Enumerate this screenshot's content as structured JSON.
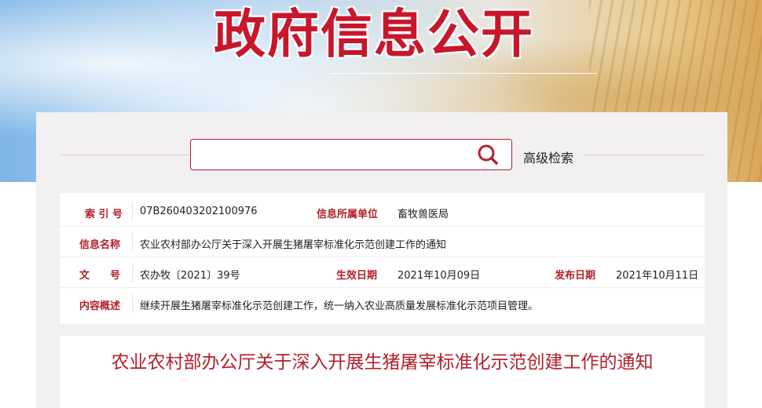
{
  "banner": {
    "title": "政府信息公开"
  },
  "search": {
    "placeholder": "",
    "advanced_label": "高级检索",
    "icon": "search-icon"
  },
  "info": {
    "index_label": "索 引 号",
    "index_value": "07B260403202100976",
    "unit_label": "信息所属单位",
    "unit_value": "畜牧兽医局",
    "name_label": "信息名称",
    "name_value": "农业农村部办公厅关于深入开展生猪屠宰标准化示范创建工作的通知",
    "doc_label": "文　　号",
    "doc_value": "农办牧〔2021〕39号",
    "effective_label": "生效日期",
    "effective_value": "2021年10月09日",
    "publish_label": "发布日期",
    "publish_value": "2021年10月11日",
    "summary_label": "内容概述",
    "summary_value": "继续开展生猪屠宰标准化示范创建工作，统一纳入农业高质量发展标准化示范项目管理。"
  },
  "document": {
    "title": "农业农村部办公厅关于深入开展生猪屠宰标准化示范创建工作的通知"
  },
  "colors": {
    "accent": "#b3202c",
    "banner_title": "#c8162b",
    "panel_bg": "#f2f0f0"
  }
}
